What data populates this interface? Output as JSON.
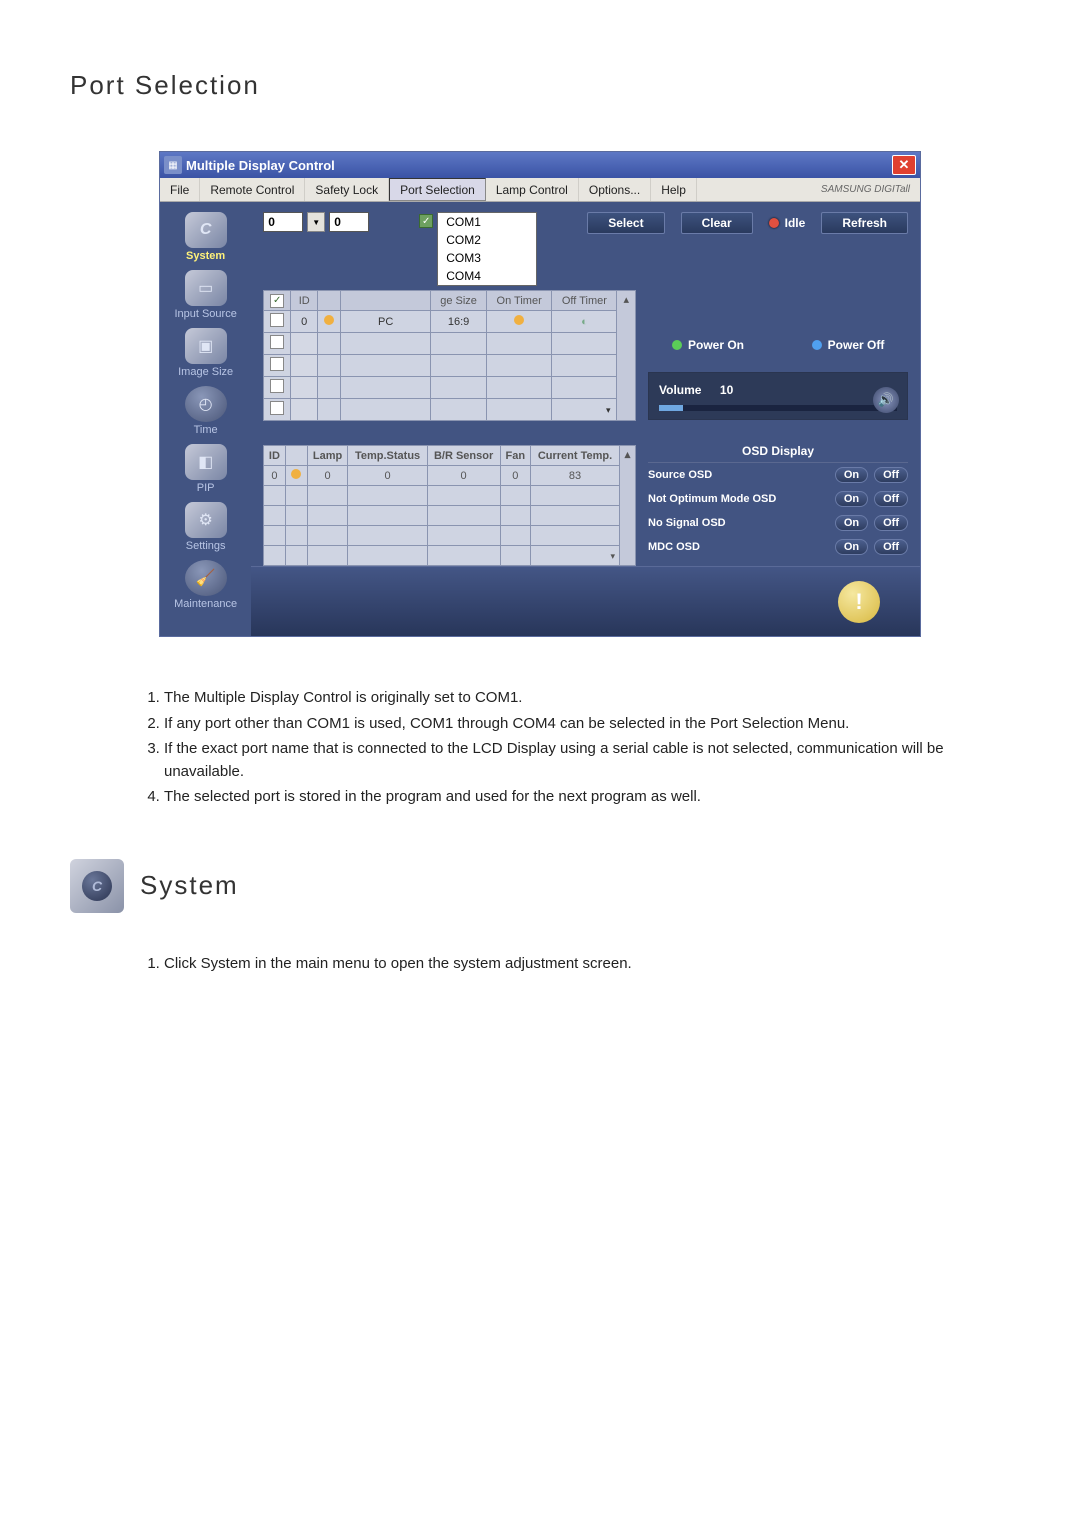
{
  "page": {
    "title": "Port Selection",
    "system_title": "System"
  },
  "window": {
    "title": "Multiple Display Control",
    "brand": "SAMSUNG DIGITall"
  },
  "menubar": {
    "file": "File",
    "remote": "Remote Control",
    "safety": "Safety Lock",
    "port": "Port Selection",
    "lamp": "Lamp Control",
    "options": "Options...",
    "help": "Help"
  },
  "sidebar": {
    "system": "System",
    "input_source": "Input Source",
    "image_size": "Image Size",
    "time": "Time",
    "pip": "PIP",
    "settings": "Settings",
    "maintenance": "Maintenance"
  },
  "id_input": {
    "left": "0",
    "right": "0"
  },
  "port_menu": {
    "com1": "COM1",
    "com2": "COM2",
    "com3": "COM3",
    "com4": "COM4"
  },
  "toolbar": {
    "select": "Select",
    "clear": "Clear",
    "idle": "Idle",
    "refresh": "Refresh",
    "power_on": "Power On",
    "power_off": "Power Off"
  },
  "table1": {
    "cols": {
      "chk": "",
      "id": "ID",
      "status": "",
      "source": "",
      "imgsize": "ge Size",
      "ontimer": "On Timer",
      "offtimer": "Off Timer"
    },
    "row1": {
      "id": "0",
      "source": "PC",
      "imgsize": "16:9"
    }
  },
  "table2": {
    "cols": {
      "id": "ID",
      "status": "",
      "lamp": "Lamp",
      "temp": "Temp.Status",
      "sensor": "B/R Sensor",
      "fan": "Fan",
      "curtemp": "Current Temp."
    },
    "row1": {
      "id": "0",
      "lamp": "0",
      "temp": "0",
      "sensor": "0",
      "fan": "0",
      "curtemp": "83"
    }
  },
  "volume": {
    "label": "Volume",
    "value": "10"
  },
  "osd": {
    "title": "OSD Display",
    "source": "Source OSD",
    "notopt": "Not Optimum Mode OSD",
    "nosignal": "No Signal OSD",
    "mdc": "MDC OSD",
    "on": "On",
    "off": "Off"
  },
  "notes": {
    "n1": "The Multiple Display Control is originally set to COM1.",
    "n2": "If any port other than COM1 is used, COM1 through COM4 can be selected in the Port Selection Menu.",
    "n3": "If the exact port name that is connected to the LCD Display using a serial cable is not selected, communication will be unavailable.",
    "n4": "The selected port is stored in the program and used for the next program as well."
  },
  "system_notes": {
    "s1": "Click System in the main menu to open the system adjustment screen."
  }
}
